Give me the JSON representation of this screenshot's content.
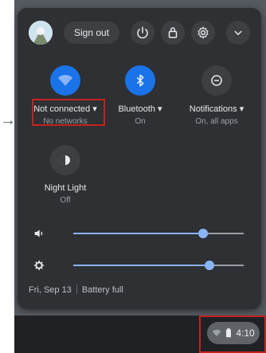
{
  "header": {
    "sign_out_label": "Sign out",
    "icons": [
      "power-icon",
      "lock-icon",
      "settings-icon",
      "collapse-icon"
    ]
  },
  "toggles": [
    {
      "label": "Not connected ▾",
      "sub": "No networks",
      "icon": "wifi-icon",
      "active": true,
      "color": "#1a73e8"
    },
    {
      "label": "Bluetooth ▾",
      "sub": "On",
      "icon": "bluetooth-icon",
      "active": true,
      "color": "#1a73e8"
    },
    {
      "label": "Notifications ▾",
      "sub": "On, all apps",
      "icon": "notifications-icon",
      "active": false,
      "color": "#3c4043"
    }
  ],
  "night_light": {
    "label": "Night Light",
    "sub": "Off"
  },
  "sliders": [
    {
      "name": "volume",
      "icon": "volume-icon",
      "value": 0.76
    },
    {
      "name": "brightness",
      "icon": "brightness-icon",
      "value": 0.8
    }
  ],
  "footer": {
    "date": "Fri, Sep 13",
    "battery": "Battery full"
  },
  "tray": {
    "time": "4:10",
    "icons": [
      "wifi-icon",
      "battery-icon"
    ]
  },
  "colors": {
    "accent": "#8ab4f8",
    "active_bubble": "#1a73e8",
    "panel": "#2e3033",
    "highlight": "#c5221f"
  }
}
